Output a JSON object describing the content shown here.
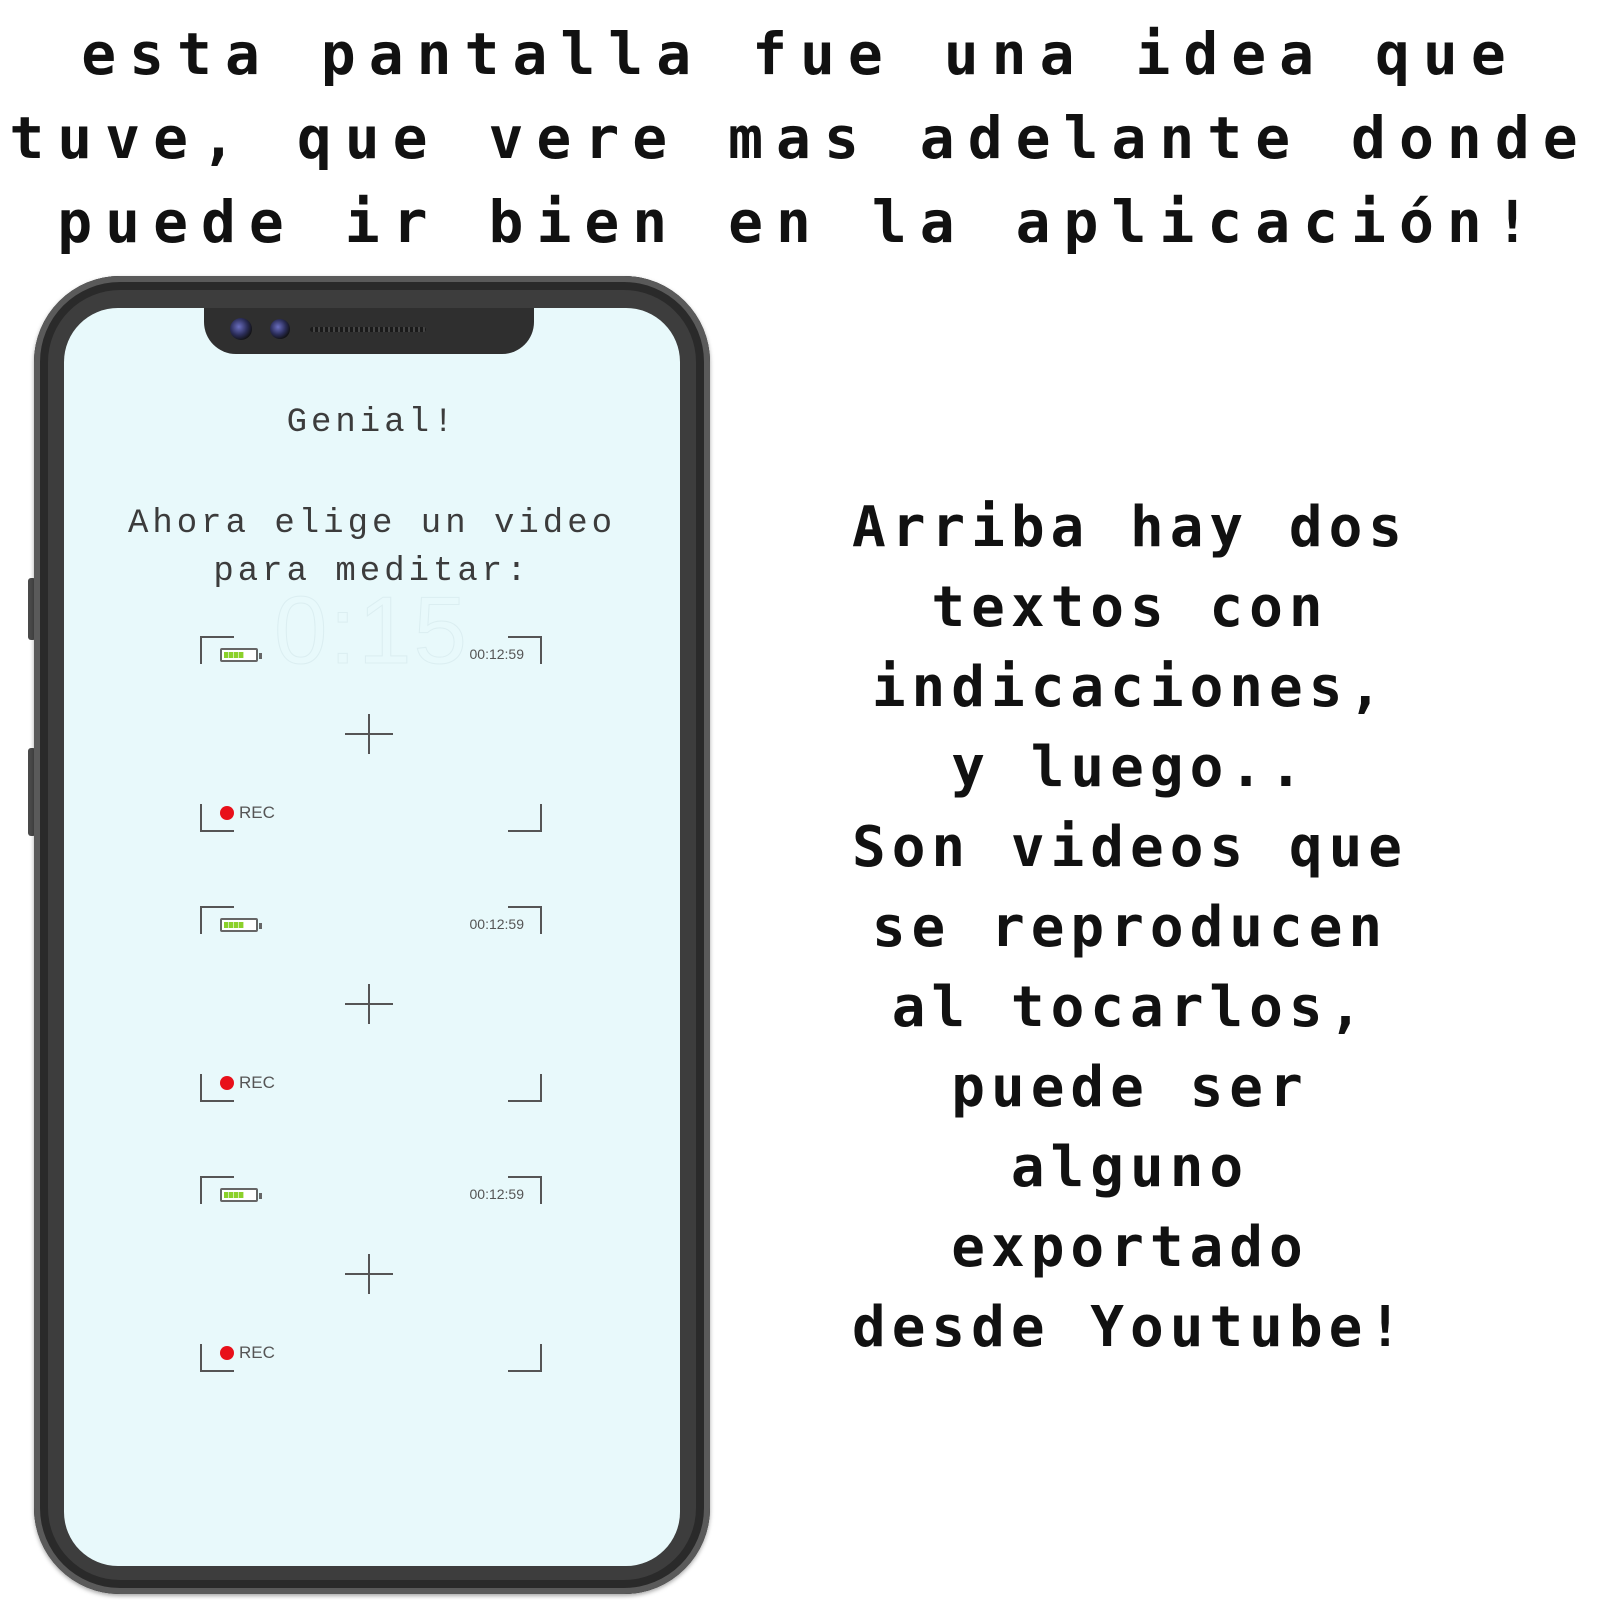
{
  "top_caption": {
    "line1": "esta pantalla fue una idea que",
    "line2": "tuve, que vere mas adelante donde",
    "line3": "puede ir bien en la aplicación!"
  },
  "side_caption": {
    "lines": [
      "Arriba hay dos",
      "textos con",
      "indicaciones,",
      "y luego..",
      "Son videos que",
      "se reproducen",
      "al tocarlos,",
      "puede ser",
      "alguno",
      "exportado",
      "desde Youtube!"
    ]
  },
  "screen": {
    "title": "Genial!",
    "subtitle_line1": "Ahora elige un video",
    "subtitle_line2": "para meditar:",
    "watermark": "0:15",
    "background_color": "#e8f9fb",
    "videos": [
      {
        "timecode": "00:12:59",
        "rec_label": "REC",
        "battery_level": 0.65
      },
      {
        "timecode": "00:12:59",
        "rec_label": "REC",
        "battery_level": 0.65
      },
      {
        "timecode": "00:12:59",
        "rec_label": "REC",
        "battery_level": 0.65
      }
    ]
  },
  "icons": {
    "camera": "camera-lens-icon",
    "battery": "battery-icon",
    "rec": "record-dot-icon",
    "crosshair": "crosshair-icon"
  },
  "colors": {
    "rec_dot": "#e8101a",
    "battery_fill": "#8bd02a",
    "phone_frame": "#3d3d3d"
  }
}
